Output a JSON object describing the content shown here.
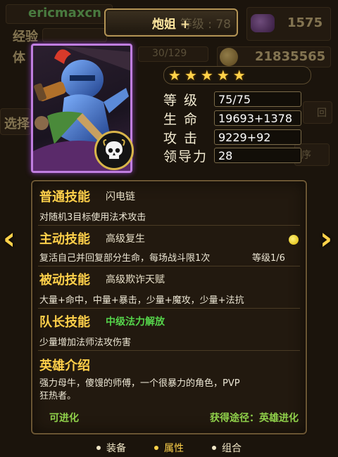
{
  "background": {
    "player_name": "ericmaxcn",
    "exp_label": "经验",
    "stamina_label": "体",
    "stamina_value": "30/129",
    "gems": "1575",
    "gold": "21835565",
    "select_button": "选择",
    "return_button": "回",
    "sort_button": "序",
    "title_ghost": "等级 : 78"
  },
  "hero": {
    "name": "炮姐 +",
    "stars_total": 5,
    "stars_filled": 5
  },
  "stats": [
    {
      "label": "等  级",
      "value": "75/75"
    },
    {
      "label": "生  命",
      "value": "19693+1378"
    },
    {
      "label": "攻  击",
      "value": "9229+92"
    },
    {
      "label": "领导力",
      "value": "28"
    }
  ],
  "skills": {
    "normal": {
      "title": "普通技能",
      "name": "闪电链",
      "desc": "对随机3目标使用法术攻击"
    },
    "active": {
      "title": "主动技能",
      "name": "高级复生",
      "desc": "复活自己并回复部分生命，每场战斗限1次",
      "level": "等级1/6"
    },
    "passive": {
      "title": "被动技能",
      "name": "高级欺诈天赋",
      "desc": "大量+命中，中量+暴击，少量+魔攻，少量+法抗"
    },
    "leader": {
      "title": "队长技能",
      "name": "中级法力解放",
      "desc": "少量增加法师法攻伤害"
    },
    "intro": {
      "title": "英雄介绍",
      "desc_line1": "强力母牛，傻馒的师傅，一个很暴力的角色，PVP",
      "desc_line2": "狂热者。"
    }
  },
  "footer": {
    "evolvable": "可进化",
    "obtain": "获得途径：英雄进化"
  },
  "tabs": [
    "装备",
    "属性",
    "组合"
  ],
  "active_tab": "属性",
  "colors": {
    "gold_text": "#ffd04a",
    "green_text": "#55d44a",
    "portrait_border": "#c07ee0"
  }
}
